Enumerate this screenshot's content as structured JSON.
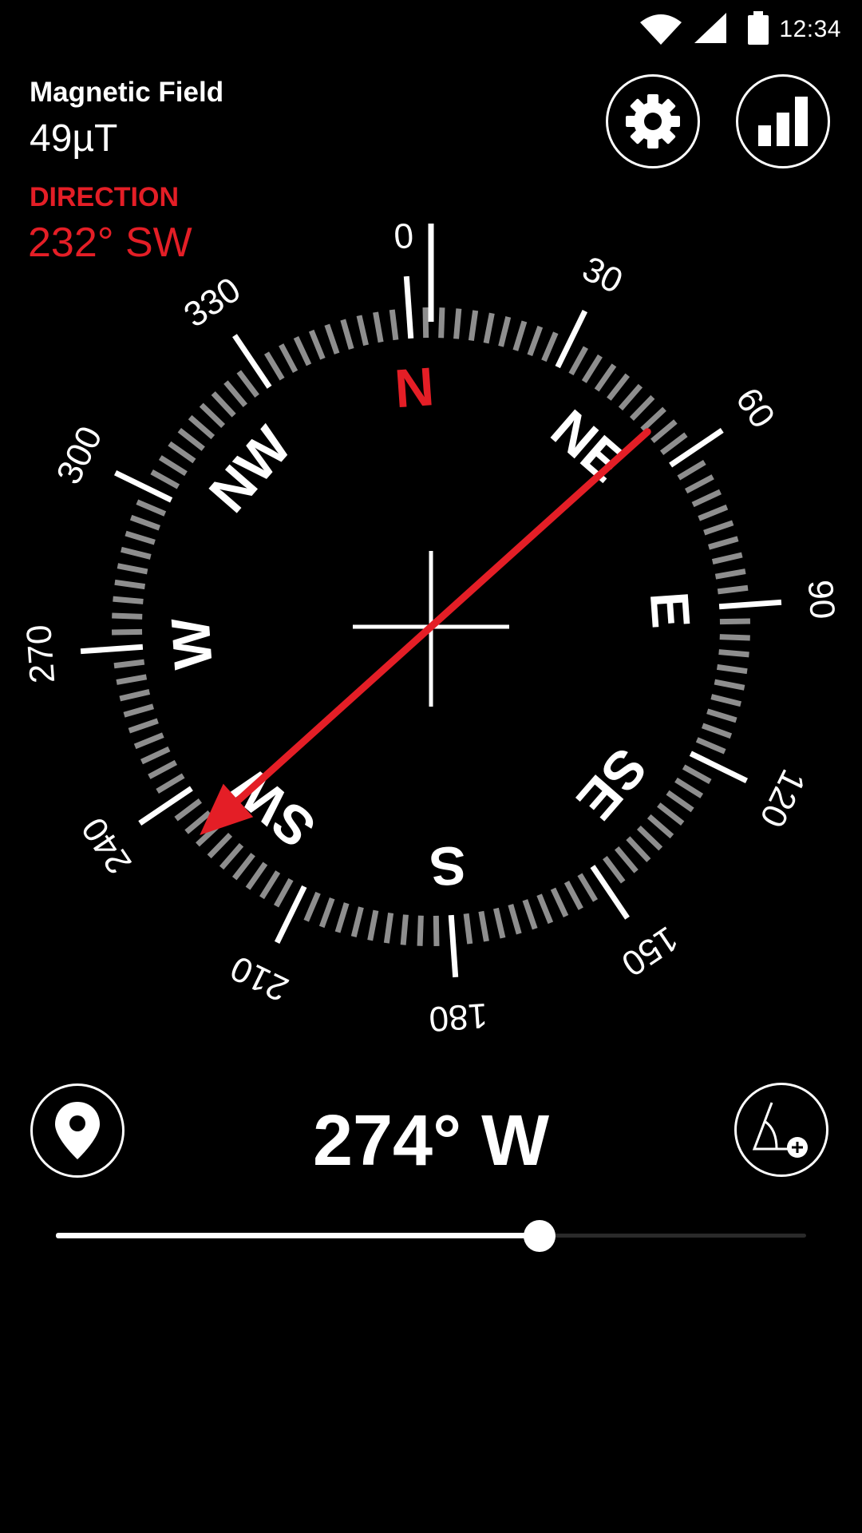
{
  "status_bar": {
    "time": "12:34",
    "icons": [
      "wifi-icon",
      "cellular-signal-icon",
      "battery-icon"
    ]
  },
  "readouts": {
    "magnetic_field_label": "Magnetic Field",
    "magnetic_field_value": "49µT",
    "direction_label": "DIRECTION",
    "direction_value": "232° SW"
  },
  "buttons": {
    "settings": "gear-icon",
    "stats": "bar-chart-icon",
    "location": "location-pin-icon",
    "angle": "angle-add-icon"
  },
  "compass": {
    "cardinals": [
      "N",
      "NE",
      "E",
      "SE",
      "S",
      "SW",
      "W",
      "NW"
    ],
    "degree_labels": [
      "0",
      "30",
      "60",
      "90",
      "120",
      "150",
      "180",
      "210",
      "240",
      "270",
      "300",
      "330"
    ],
    "rotation_degrees": 274,
    "direction_arrow_degrees": 232,
    "accent_color": "#e41e26"
  },
  "heading": {
    "text": "274° W"
  },
  "slider": {
    "value_fraction": 0.645
  }
}
